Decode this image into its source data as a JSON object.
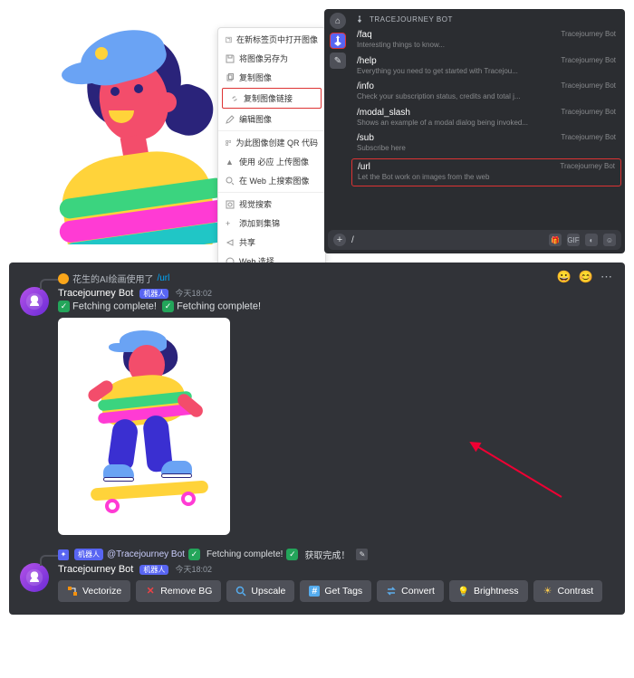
{
  "context_menu": {
    "items": [
      {
        "label": "在新标签页中打开图像",
        "icon": "open-new-tab"
      },
      {
        "label": "将图像另存为",
        "icon": "save"
      },
      {
        "label": "复制图像",
        "icon": "copy"
      },
      {
        "label": "复制图像链接",
        "icon": "link",
        "highlight": true
      },
      {
        "label": "编辑图像",
        "icon": "edit"
      }
    ],
    "items2": [
      {
        "label": "为此图像创建 QR 代码",
        "icon": "qr"
      },
      {
        "label": "使用 必应 上传图像",
        "icon": "upload"
      },
      {
        "label": "在 Web 上搜索图像",
        "icon": "search"
      }
    ],
    "items3": [
      {
        "label": "视觉搜索",
        "icon": "visual"
      },
      {
        "label": "添加到集锦",
        "icon": "collection"
      },
      {
        "label": "共享",
        "icon": "share"
      },
      {
        "label": "Web 选择",
        "icon": "web"
      }
    ]
  },
  "slash": {
    "header": "TRACEJOURNEY BOT",
    "bot_label": "Tracejourney Bot",
    "commands": [
      {
        "name": "/faq",
        "desc": "Interesting things to know..."
      },
      {
        "name": "/help",
        "desc": "Everything you need to get started with Tracejou..."
      },
      {
        "name": "/info",
        "desc": "Check your subscription status, credits and total j..."
      },
      {
        "name": "/modal_slash",
        "desc": "Shows an example of a modal dialog being invoked..."
      },
      {
        "name": "/sub",
        "desc": "Subscribe here"
      },
      {
        "name": "/url",
        "desc": "Let the Bot work on images from the web",
        "highlight": true
      }
    ],
    "input": "/"
  },
  "chat": {
    "reply1": {
      "user": "花生的AI绘画使用了",
      "cmd": "/url"
    },
    "msg1": {
      "username": "Tracejourney Bot",
      "bot_tag": "机器人",
      "time": "今天18:02",
      "status1": "Fetching complete!",
      "status2": "Fetching complete!"
    },
    "reply2": {
      "bot_tag": "机器人",
      "mention": "@Tracejourney Bot",
      "status1": "Fetching complete!",
      "status2": "获取完成！"
    },
    "msg2": {
      "username": "Tracejourney Bot",
      "bot_tag": "机器人",
      "time": "今天18:02"
    },
    "buttons": {
      "vectorize": "Vectorize",
      "removebg": "Remove BG",
      "upscale": "Upscale",
      "gettags": "Get Tags",
      "convert": "Convert",
      "brightness": "Brightness",
      "contrast": "Contrast"
    }
  }
}
